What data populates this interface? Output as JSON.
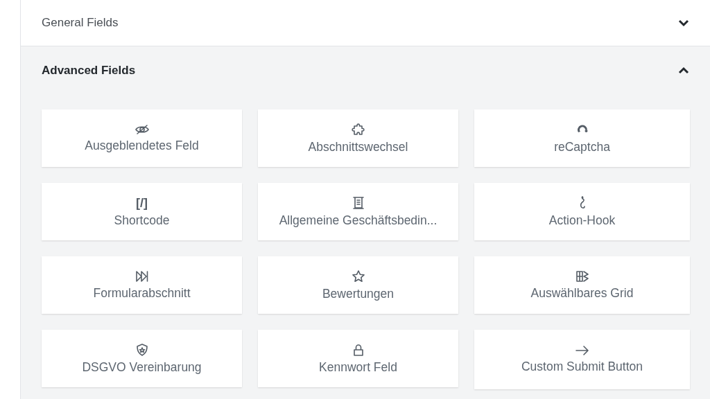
{
  "sections": [
    {
      "title": "General Fields",
      "expanded": false
    },
    {
      "title": "Advanced Fields",
      "expanded": true,
      "fields": [
        {
          "label": "Ausgeblendetes Feld"
        },
        {
          "label": "Abschnittswechsel"
        },
        {
          "label": "reCaptcha"
        },
        {
          "label": "[/]",
          "kind": "glyph-icon",
          "caption": "Shortcode"
        },
        {
          "label": "Allgemeine Geschäftsbedin..."
        },
        {
          "label": "Action-Hook"
        },
        {
          "label": "Formularabschnitt"
        },
        {
          "label": "Bewertungen"
        },
        {
          "label": "Auswählbares Grid"
        },
        {
          "label": "DSGVO Vereinbarung"
        },
        {
          "label": "Kennwort Feld"
        },
        {
          "label": "Custom Submit Button"
        }
      ]
    }
  ]
}
